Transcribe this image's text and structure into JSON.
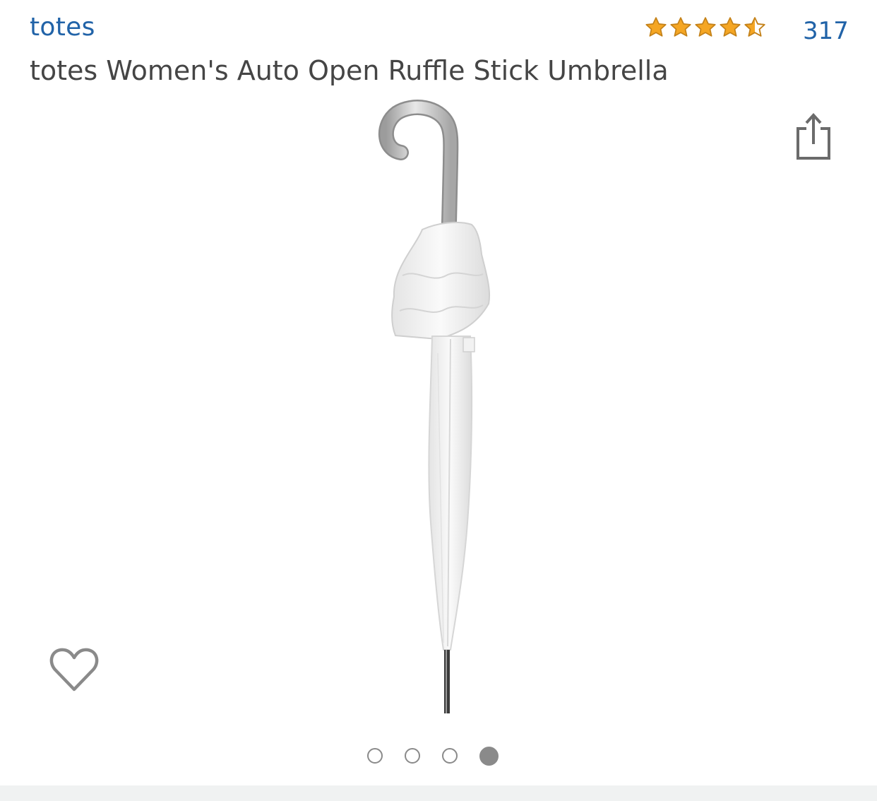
{
  "header": {
    "brand": "totes",
    "rating_value": 4.5,
    "rating_max": 5,
    "review_count": "317"
  },
  "product": {
    "title": "totes Women's Auto Open Ruffle Stick Umbrella"
  },
  "icons": {
    "share": "share-icon",
    "wishlist": "heart-icon",
    "star": "star-icon"
  },
  "carousel": {
    "total": 4,
    "active_index": 4
  },
  "colors": {
    "link": "#2163a8",
    "title": "#454545",
    "star_fill": "#f5a623",
    "star_outline": "#c4821a",
    "icon_gray": "#8a8a8a"
  }
}
